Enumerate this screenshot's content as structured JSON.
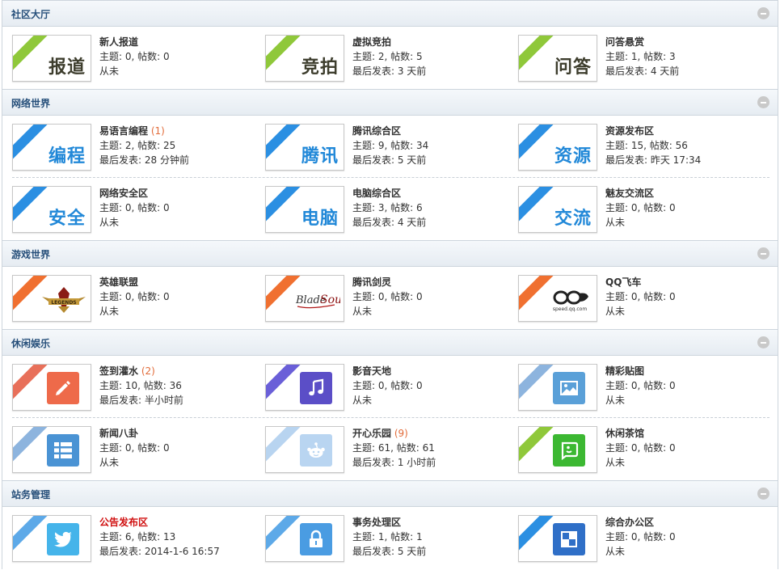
{
  "sections": [
    {
      "title": "社区大厅",
      "rows": [
        [
          {
            "name": "新人报道",
            "icon_text": "报道",
            "ribbon": "green",
            "stats": "主题: 0, 帖数: 0",
            "last": "从未"
          },
          {
            "name": "虚拟竞拍",
            "icon_text": "竞拍",
            "ribbon": "green",
            "stats": "主题: 2, 帖数: 5",
            "last": "最后发表: 3 天前"
          },
          {
            "name": "问答悬赏",
            "icon_text": "问答",
            "ribbon": "green",
            "stats": "主题: 1, 帖数: 3",
            "last": "最后发表: 4 天前"
          }
        ]
      ]
    },
    {
      "title": "网络世界",
      "rows": [
        [
          {
            "name": "易语言编程",
            "new": "(1)",
            "icon_text": "编程",
            "ribbon": "blue",
            "stats": "主题: 2, 帖数: 25",
            "last": "最后发表: 28 分钟前"
          },
          {
            "name": "腾讯综合区",
            "icon_text": "腾讯",
            "ribbon": "blue",
            "stats": "主题: 9, 帖数: 34",
            "last": "最后发表: 5 天前"
          },
          {
            "name": "资源发布区",
            "icon_text": "资源",
            "ribbon": "blue",
            "stats": "主题: 15, 帖数: 56",
            "last": "最后发表: 昨天 17:34"
          }
        ],
        [
          {
            "name": "网络安全区",
            "icon_text": "安全",
            "ribbon": "blue",
            "stats": "主题: 0, 帖数: 0",
            "last": "从未"
          },
          {
            "name": "电脑综合区",
            "icon_text": "电脑",
            "ribbon": "blue",
            "stats": "主题: 3, 帖数: 6",
            "last": "最后发表: 4 天前"
          },
          {
            "name": "魅友交流区",
            "icon_text": "交流",
            "ribbon": "blue",
            "stats": "主题: 0, 帖数: 0",
            "last": "从未"
          }
        ]
      ]
    },
    {
      "title": "游戏世界",
      "rows": [
        [
          {
            "name": "英雄联盟",
            "icon": "lol-logo-icon",
            "ribbon": "orange",
            "stats": "主题: 0, 帖数: 0",
            "last": "从未"
          },
          {
            "name": "腾讯剑灵",
            "icon": "blade-soul-logo-icon",
            "ribbon": "orange",
            "stats": "主题: 0, 帖数: 0",
            "last": "从未"
          },
          {
            "name": "QQ飞车",
            "icon": "qq-speed-logo-icon",
            "ribbon": "orange",
            "stats": "主题: 0, 帖数: 0",
            "last": "从未"
          }
        ]
      ]
    },
    {
      "title": "休闲娱乐",
      "rows": [
        [
          {
            "name": "签到灌水",
            "new": "(2)",
            "icon": "pencil-icon",
            "ribbon": "red",
            "stats": "主题: 10, 帖数: 36",
            "last": "最后发表: 半小时前"
          },
          {
            "name": "影音天地",
            "icon": "music-note-icon",
            "ribbon": "purple",
            "stats": "主题: 0, 帖数: 0",
            "last": "从未"
          },
          {
            "name": "精彩贴图",
            "icon": "picture-icon",
            "ribbon": "lblue",
            "stats": "主题: 0, 帖数: 0",
            "last": "从未"
          }
        ],
        [
          {
            "name": "新闻八卦",
            "icon": "list-icon",
            "ribbon": "lblue",
            "stats": "主题: 0, 帖数: 0",
            "last": "从未"
          },
          {
            "name": "开心乐园",
            "new": "(9)",
            "icon": "reddit-icon",
            "ribbon": "pale",
            "stats": "主题: 61, 帖数: 61",
            "last": "最后发表: 1 小时前"
          },
          {
            "name": "休闲茶馆",
            "icon": "chat-bubble-icon",
            "ribbon": "green",
            "stats": "主题: 0, 帖数: 0",
            "last": "从未"
          }
        ]
      ]
    },
    {
      "title": "站务管理",
      "rows": [
        [
          {
            "name": "公告发布区",
            "red": true,
            "icon": "twitter-bird-icon",
            "ribbon": "sky",
            "stats": "主题: 6, 帖数: 13",
            "last": "最后发表: 2014-1-6 16:57"
          },
          {
            "name": "事务处理区",
            "icon": "lock-icon",
            "ribbon": "sky",
            "stats": "主题: 1, 帖数: 1",
            "last": "最后发表: 5 天前"
          },
          {
            "name": "综合办公区",
            "icon": "office-grid-icon",
            "ribbon": "blue",
            "stats": "主题: 0, 帖数: 0",
            "last": "从未"
          }
        ]
      ]
    }
  ]
}
